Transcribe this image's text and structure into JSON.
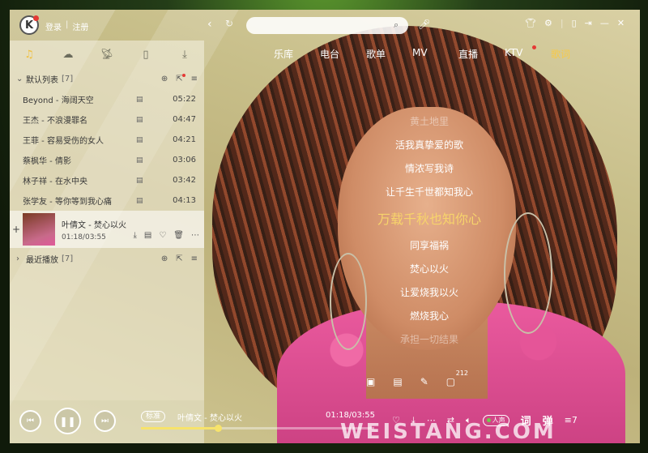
{
  "header": {
    "logo_letter": "K",
    "login": "登录",
    "divider": "|",
    "register": "注册",
    "back_icon": "chevron-left-icon",
    "search_placeholder": "",
    "tabs": [
      {
        "label": "乐库"
      },
      {
        "label": "电台"
      },
      {
        "label": "歌单"
      },
      {
        "label": "MV"
      },
      {
        "label": "直播"
      },
      {
        "label": "KTV"
      },
      {
        "label": "歌词"
      }
    ],
    "active_tab": "歌词"
  },
  "sidebar": {
    "groups": [
      {
        "title": "默认列表",
        "count": "[7]"
      },
      {
        "title": "最近播放",
        "count": "[7]"
      }
    ],
    "songs": [
      {
        "name": "Beyond - 海阔天空",
        "duration": "05:22"
      },
      {
        "name": "王杰 - 不浪漫罪名",
        "duration": "04:47"
      },
      {
        "name": "王菲 - 容易受伤的女人",
        "duration": "04:21"
      },
      {
        "name": "蔡枫华 - 倩影",
        "duration": "03:06"
      },
      {
        "name": "林子祥 - 在水中央",
        "duration": "03:42"
      },
      {
        "name": "张学友 - 等你等到我心痛",
        "duration": "04:13"
      }
    ],
    "now_playing": {
      "name": "叶倩文 - 焚心以火",
      "time": "01:18/03:55"
    }
  },
  "lyrics": {
    "lines": [
      "黄土地里",
      "活我真挚爱的歌",
      "情浓写我诗",
      "让千生千世都知我心",
      "万载千秋也知你心",
      "同享福祸",
      "焚心以火",
      "让爱烧我以火",
      "燃烧我心",
      "承担一切结果"
    ],
    "current_index": 4,
    "comment_count": "212"
  },
  "player": {
    "quality": "标准",
    "title": "叶倩文 - 焚心以火",
    "time": "01:18/03:55",
    "progress": 0.33,
    "sound_label": "人声",
    "lyric_label": "词",
    "danmaku_label": "弹",
    "playlist_count": "7"
  },
  "watermark": "WEISTANG.COM"
}
